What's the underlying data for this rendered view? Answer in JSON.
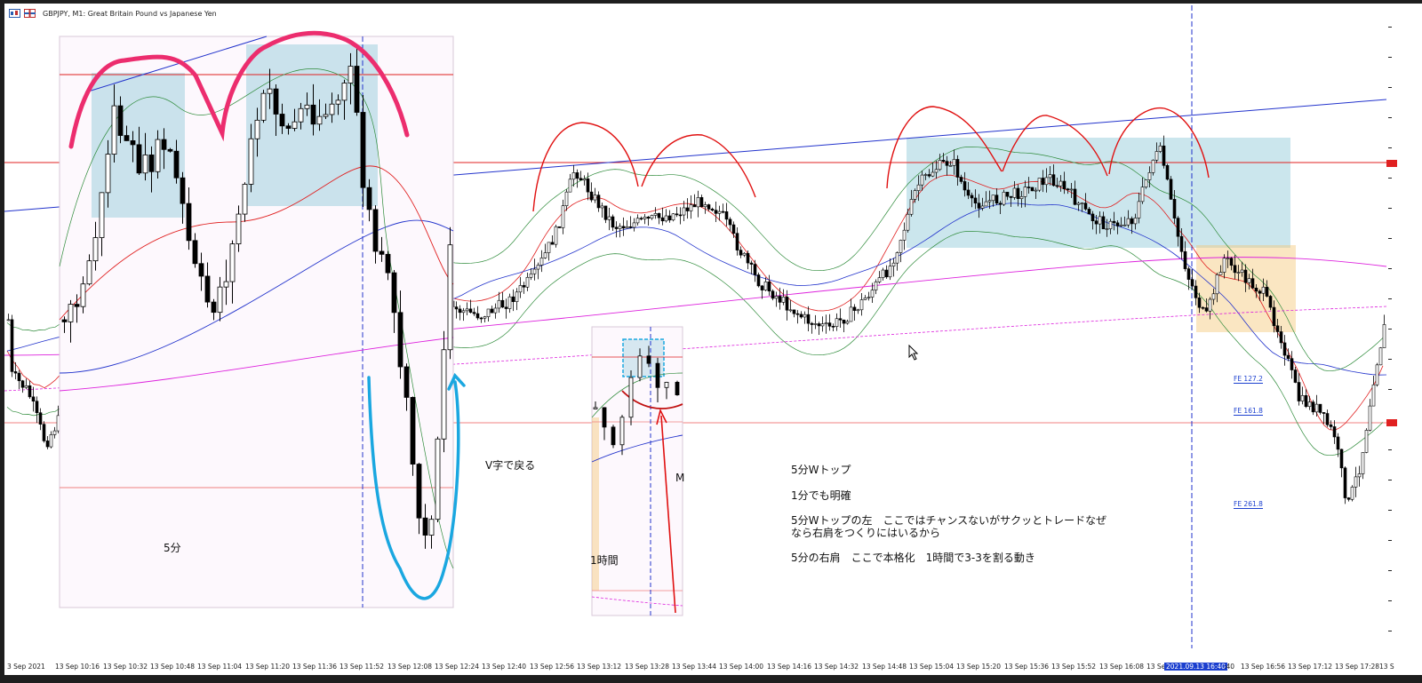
{
  "window": {
    "title": "GBPJPY, M1:  Great Britain Pound vs Japanese Yen"
  },
  "x_axis": {
    "labels": [
      "3 Sep 2021",
      "13 Sep 10:16",
      "13 Sep 10:32",
      "13 Sep 10:48",
      "13 Sep 11:04",
      "13 Sep 11:20",
      "13 Sep 11:36",
      "13 Sep 11:52",
      "13 Sep 12:08",
      "13 Sep 12:24",
      "13 Sep 12:40",
      "13 Sep 12:56",
      "13 Sep 13:12",
      "13 Sep 13:28",
      "13 Sep 13:44",
      "13 Sep 14:00",
      "13 Sep 14:16",
      "13 Sep 14:32",
      "13 Sep 14:48",
      "13 Sep 15:04",
      "13 Sep 15:20",
      "13 Sep 15:36",
      "13 Sep 15:52",
      "13 Sep 16:08",
      "13 Se",
      "13 Sep 16:56",
      "13 Sep 17:12",
      "13 Sep 17:28",
      "13 S"
    ],
    "highlighted": "2021.09.13 16:40",
    "after_highlight": ":40"
  },
  "annotations": {
    "v_return": "V字で戻る",
    "five_min": "5分",
    "one_hour": "1時間",
    "inset_m": "M",
    "note1": "5分Wトップ",
    "note2": "1分でも明確",
    "note3a": "5分Wトップの左　ここではチャンスないがサクッとトレードなぜ",
    "note3b": "なら右肩をつくりにはいるから",
    "note4": "5分の右肩　ここで本格化　1時間で3-3を割る動き"
  },
  "fibo": {
    "fe1": "FE  127.2",
    "fe2": "FE  161.8",
    "fe3": "FE  261.8"
  },
  "colors": {
    "bull": "#ffffff",
    "bear": "#000000",
    "red_line": "#e02020",
    "blue_line": "#2233cc",
    "magenta": "#dd22dd",
    "bb_green": "#2e8b3a",
    "pink_marker": "#ec2d6e",
    "cyan_marker": "#1aa7e0",
    "teal_zone": "rgba(140,200,215,0.45)",
    "orange_zone": "rgba(245,200,120,0.45)"
  }
}
